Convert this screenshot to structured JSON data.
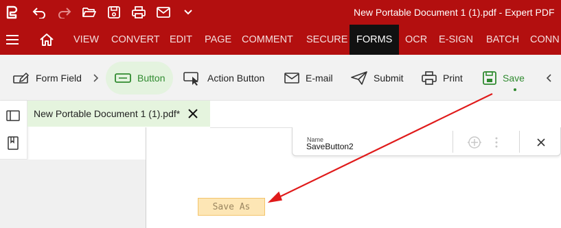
{
  "titlebar": {
    "title": "New Portable Document 1 (1).pdf   -   Expert PDF",
    "quick_access": [
      "app-logo-icon",
      "undo-icon",
      "redo-icon",
      "open-folder-icon",
      "save-disk-icon",
      "print-icon",
      "email-icon",
      "chevron-down-icon"
    ]
  },
  "menubar": {
    "items": [
      {
        "label": "VIEW"
      },
      {
        "label": "CONVERT"
      },
      {
        "label": "EDIT"
      },
      {
        "label": "PAGE"
      },
      {
        "label": "COMMENT"
      },
      {
        "label": "SECURE"
      },
      {
        "label": "FORMS"
      },
      {
        "label": "OCR"
      },
      {
        "label": "E-SIGN"
      },
      {
        "label": "BATCH"
      },
      {
        "label": "CONN"
      }
    ],
    "active": "FORMS"
  },
  "ribbon": {
    "form_field": "Form Field",
    "button": "Button",
    "action_button": "Action Button",
    "email": "E-mail",
    "submit": "Submit",
    "print": "Print",
    "save": "Save"
  },
  "document_tab": {
    "name": "New Portable Document 1 (1).pdf*"
  },
  "property_bar": {
    "name_label": "Name",
    "name_value": "SaveButton2"
  },
  "form_button": {
    "label": "Save As"
  },
  "colors": {
    "titlebar": "#b30f0f",
    "active_tab": "#111111",
    "selected_green": "#2f8a2f",
    "selected_bg": "#e4f3df",
    "form_button_bg": "#fde6b5",
    "arrow": "#e01b1b"
  }
}
